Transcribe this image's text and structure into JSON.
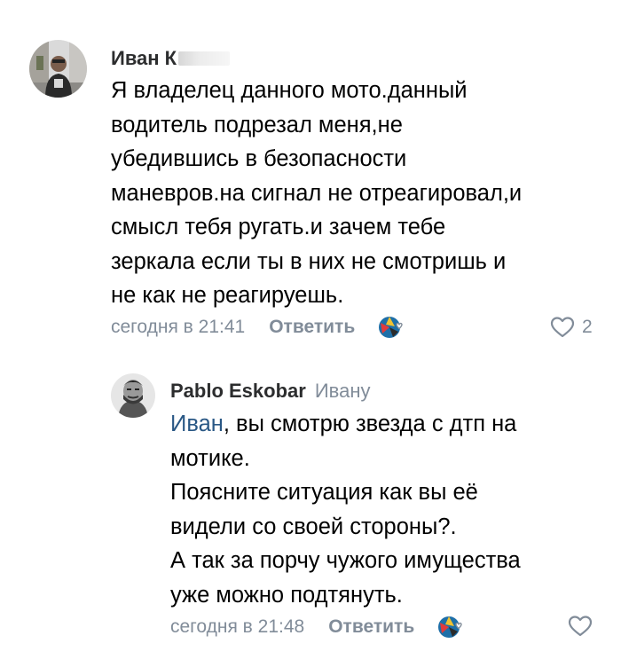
{
  "comments": [
    {
      "author": "Иван К",
      "lines": [
        "Я владелец данного мото.данный",
        "водитель подрезал меня,не",
        "убедившись в безопасности",
        "маневров.на сигнал не отреагировал,и",
        "смысл тебя ругать.и зачем тебе",
        "зеркала если ты в них не смотришь и",
        "не как не реагируешь."
      ],
      "timestamp": "сегодня в 21:41",
      "reply_label": "Ответить",
      "likes": "2"
    },
    {
      "author": "Pablo Eskobar",
      "reply_to": "Ивану",
      "mention": "Иван",
      "first_line_rest": ", вы смотрю звезда с дтп на",
      "lines": [
        "мотике.",
        "Поясните ситуация как вы её",
        "видели со своей стороны?.",
        "А так за порчу чужого имущества",
        "уже можно подтянуть."
      ],
      "timestamp": "сегодня в 21:48",
      "reply_label": "Ответить",
      "likes": ""
    }
  ],
  "colors": {
    "link": "#2a5885",
    "secondary": "#818c99",
    "text": "#000000"
  },
  "icons": [
    "avatar",
    "reaction-icon",
    "heart-outline-icon"
  ]
}
